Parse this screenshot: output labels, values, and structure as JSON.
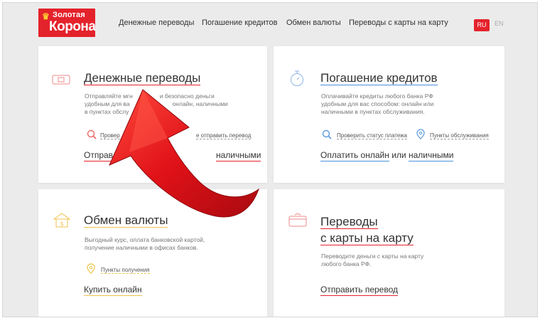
{
  "header": {
    "logo": {
      "line1": "Золотая",
      "line2": "Корона"
    },
    "nav": [
      "Денежные переводы",
      "Погашение кредитов",
      "Обмен валюты",
      "Переводы с карты на карту"
    ],
    "lang": {
      "ru": "RU",
      "en": "EN"
    }
  },
  "cards": {
    "transfers": {
      "title": "Денежные переводы",
      "desc1": "Отправляйте мгн",
      "desc2": "и безопасно деньги",
      "desc3": "удобным для ва",
      "desc4": "онлайн, наличными",
      "desc5": "в пунктах обслу",
      "link1": "Провер",
      "link2": "е отправить перевод",
      "action1": "Отправ",
      "action2": "наличными"
    },
    "credits": {
      "title": "Погашение кредитов",
      "desc": [
        "Оплачивайте кредиты любого банка РФ",
        "удобным для вас способом: онлайн или",
        "наличными в пунктах обслуживания."
      ],
      "link1": "Проверить статус платежа",
      "link2": "Пункты обслуживания",
      "action_online": "Оплатить онлайн",
      "action_or": "или",
      "action_cash": "наличными"
    },
    "exchange": {
      "title": "Обмен валюты",
      "desc": [
        "Выгодный курс, оплата банковской картой,",
        "получение наличными в офисах банков."
      ],
      "link": "Пункты получения",
      "action": "Купить онлайн"
    },
    "card2card": {
      "title1": "Переводы",
      "title2": "с карты на карту",
      "desc": [
        "Переводите деньги с карты на карту",
        "любого банка РФ."
      ],
      "action": "Отправить перевод"
    }
  },
  "colors": {
    "brand_red": "#e4222b",
    "link_blue": "#4a90d9",
    "accent_yellow": "#f0c24b",
    "overlay_arrow_red": "#d9121b"
  }
}
